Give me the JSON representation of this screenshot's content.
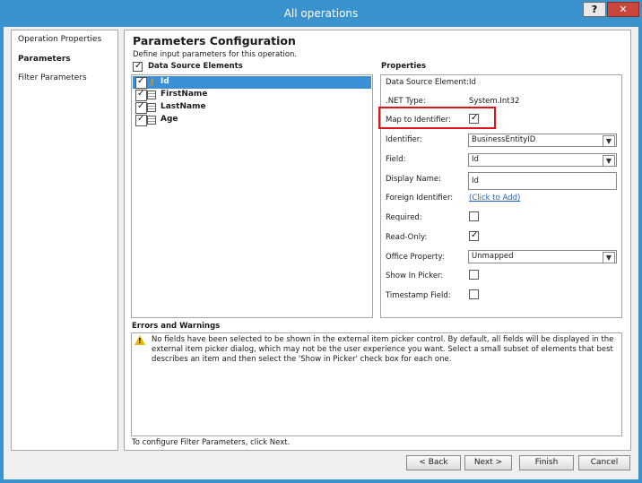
{
  "window": {
    "title": "All operations",
    "help_label": "?",
    "close_label": "✕"
  },
  "nav": {
    "items": [
      "Operation Properties",
      "Parameters",
      "Filter Parameters"
    ]
  },
  "main": {
    "heading": "Parameters Configuration",
    "subheading": "Define input parameters for this operation.",
    "dse_label": "Data Source Elements",
    "tree": [
      {
        "label": "Id",
        "checked": true,
        "icon": "key-icon"
      },
      {
        "label": "FirstName",
        "checked": true,
        "icon": "table-icon"
      },
      {
        "label": "LastName",
        "checked": true,
        "icon": "table-icon"
      },
      {
        "label": "Age",
        "checked": true,
        "icon": "table-icon"
      }
    ]
  },
  "properties": {
    "header": "Properties",
    "data_source_element_label": "Data Source Element:",
    "data_source_element_value": "Id",
    "net_type_label": ".NET Type:",
    "net_type_value": "System.Int32",
    "map_to_identifier_label": "Map to Identifier:",
    "identifier_label": "Identifier:",
    "identifier_value": "BusinessEntityID",
    "field_label": "Field:",
    "field_value": "Id",
    "display_name_label": "Display Name:",
    "display_name_value": "Id",
    "foreign_identifier_label": "Foreign Identifier:",
    "foreign_identifier_link": "(Click to Add)",
    "required_label": "Required:",
    "readonly_label": "Read-Only:",
    "office_property_label": "Office Property:",
    "office_property_value": "Unmapped",
    "show_in_picker_label": "Show In Picker:",
    "timestamp_field_label": "Timestamp Field:"
  },
  "errors": {
    "header": "Errors and Warnings",
    "message": "No fields have been selected to be shown in the external item picker control. By default, all fields will be displayed in the external item picker dialog, which may not be the user experience you want. Select a small subset of elements that best describes an item and then select the 'Show in Picker' check box for each one."
  },
  "footer": {
    "hint": "To configure Filter Parameters, click Next."
  },
  "buttons": {
    "back": "< Back",
    "next": "Next >",
    "finish": "Finish",
    "cancel": "Cancel"
  },
  "colors": {
    "title_bar": "#3a93cc",
    "selection": "#3a8fd5",
    "highlight_box": "#e0141b",
    "link": "#2a62b5"
  }
}
